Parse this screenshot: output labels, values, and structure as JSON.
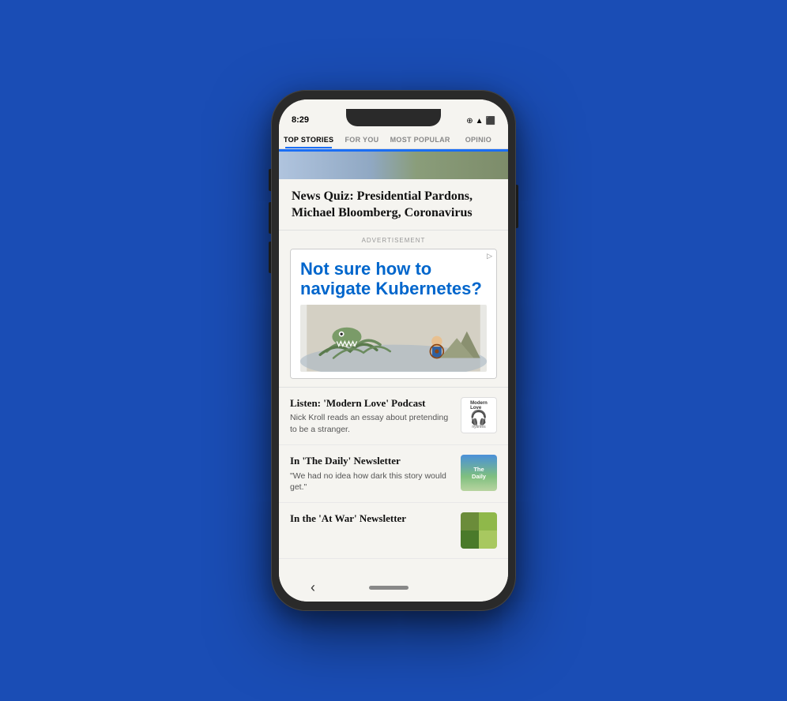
{
  "background_color": "#1a4db5",
  "phone": {
    "status_bar": {
      "time": "8:29",
      "icons": "⊕ ▲ ◉ △ ⬛"
    },
    "nav_tabs": [
      {
        "label": "TOP STORIES",
        "active": true
      },
      {
        "label": "FOR YOU",
        "active": false
      },
      {
        "label": "MOST POPULAR",
        "active": false
      },
      {
        "label": "OPINIO",
        "active": false
      }
    ],
    "headline": {
      "text": "News Quiz: Presidential Pardons, Michael Bloomberg, Coronavirus"
    },
    "advertisement": {
      "label": "ADVERTISEMENT",
      "corner_icon": "▷",
      "headline": "Not sure how to navigate Kubernetes?"
    },
    "news_items": [
      {
        "title": "Listen: 'Modern Love' Podcast",
        "description": "Nick Kroll reads an essay about pretending to be a stranger.",
        "thumb_type": "modern-love"
      },
      {
        "title": "In 'The Daily' Newsletter",
        "description": "\"We had no idea how dark this story would get.\"",
        "thumb_type": "daily"
      },
      {
        "title": "In the 'At War' Newsletter",
        "description": "",
        "thumb_type": "at-war"
      }
    ],
    "bottom_bar": {
      "back_arrow": "‹"
    }
  }
}
